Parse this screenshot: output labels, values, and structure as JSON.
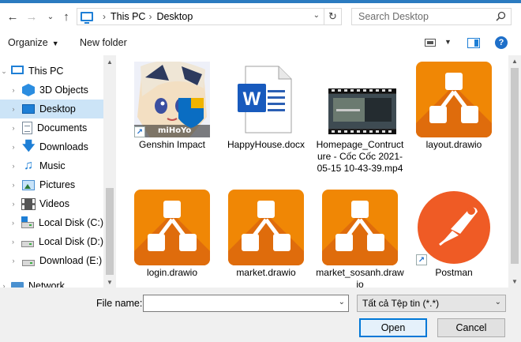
{
  "address": {
    "crumbs": [
      "This PC",
      "Desktop"
    ]
  },
  "search": {
    "placeholder": "Search Desktop"
  },
  "toolbar": {
    "organize": "Organize",
    "new_folder": "New folder"
  },
  "nav": {
    "items": [
      {
        "label": "This PC",
        "icon": "computer-icon"
      },
      {
        "label": "3D Objects",
        "icon": "cube-icon"
      },
      {
        "label": "Desktop",
        "icon": "desktop-icon"
      },
      {
        "label": "Documents",
        "icon": "document-icon"
      },
      {
        "label": "Downloads",
        "icon": "download-arrow-icon"
      },
      {
        "label": "Music",
        "icon": "music-note-icon"
      },
      {
        "label": "Pictures",
        "icon": "picture-icon"
      },
      {
        "label": "Videos",
        "icon": "film-icon"
      },
      {
        "label": "Local Disk (C:)",
        "icon": "drive-icon"
      },
      {
        "label": "Local Disk (D:)",
        "icon": "drive-icon"
      },
      {
        "label": "Download (E:)",
        "icon": "drive-icon"
      },
      {
        "label": "Network",
        "icon": "network-icon"
      }
    ]
  },
  "files": [
    {
      "name": "Genshin Impact",
      "icon": "genshin-shortcut-icon"
    },
    {
      "name": "HappyHouse.docx",
      "icon": "word-document-icon"
    },
    {
      "name": "Homepage_Contructure - Cốc Cốc 2021-05-15 10-43-39.mp4",
      "icon": "video-thumbnail-icon"
    },
    {
      "name": "layout.drawio",
      "icon": "drawio-icon"
    },
    {
      "name": "login.drawio",
      "icon": "drawio-icon"
    },
    {
      "name": "market.drawio",
      "icon": "drawio-icon"
    },
    {
      "name": "market_sosanh.drawio",
      "icon": "drawio-icon"
    },
    {
      "name": "Postman",
      "icon": "postman-shortcut-icon"
    }
  ],
  "genshin_logo_text": "miHoYo",
  "bottom": {
    "file_name_label": "File name:",
    "file_name_value": "",
    "file_type": "Tất cả Tệp tin (*.*)",
    "open": "Open",
    "cancel": "Cancel"
  },
  "colors": {
    "accent": "#0078d7",
    "selection": "#cce4f7",
    "drawio_orange": "#f08705",
    "postman_orange": "#ef5b25"
  }
}
